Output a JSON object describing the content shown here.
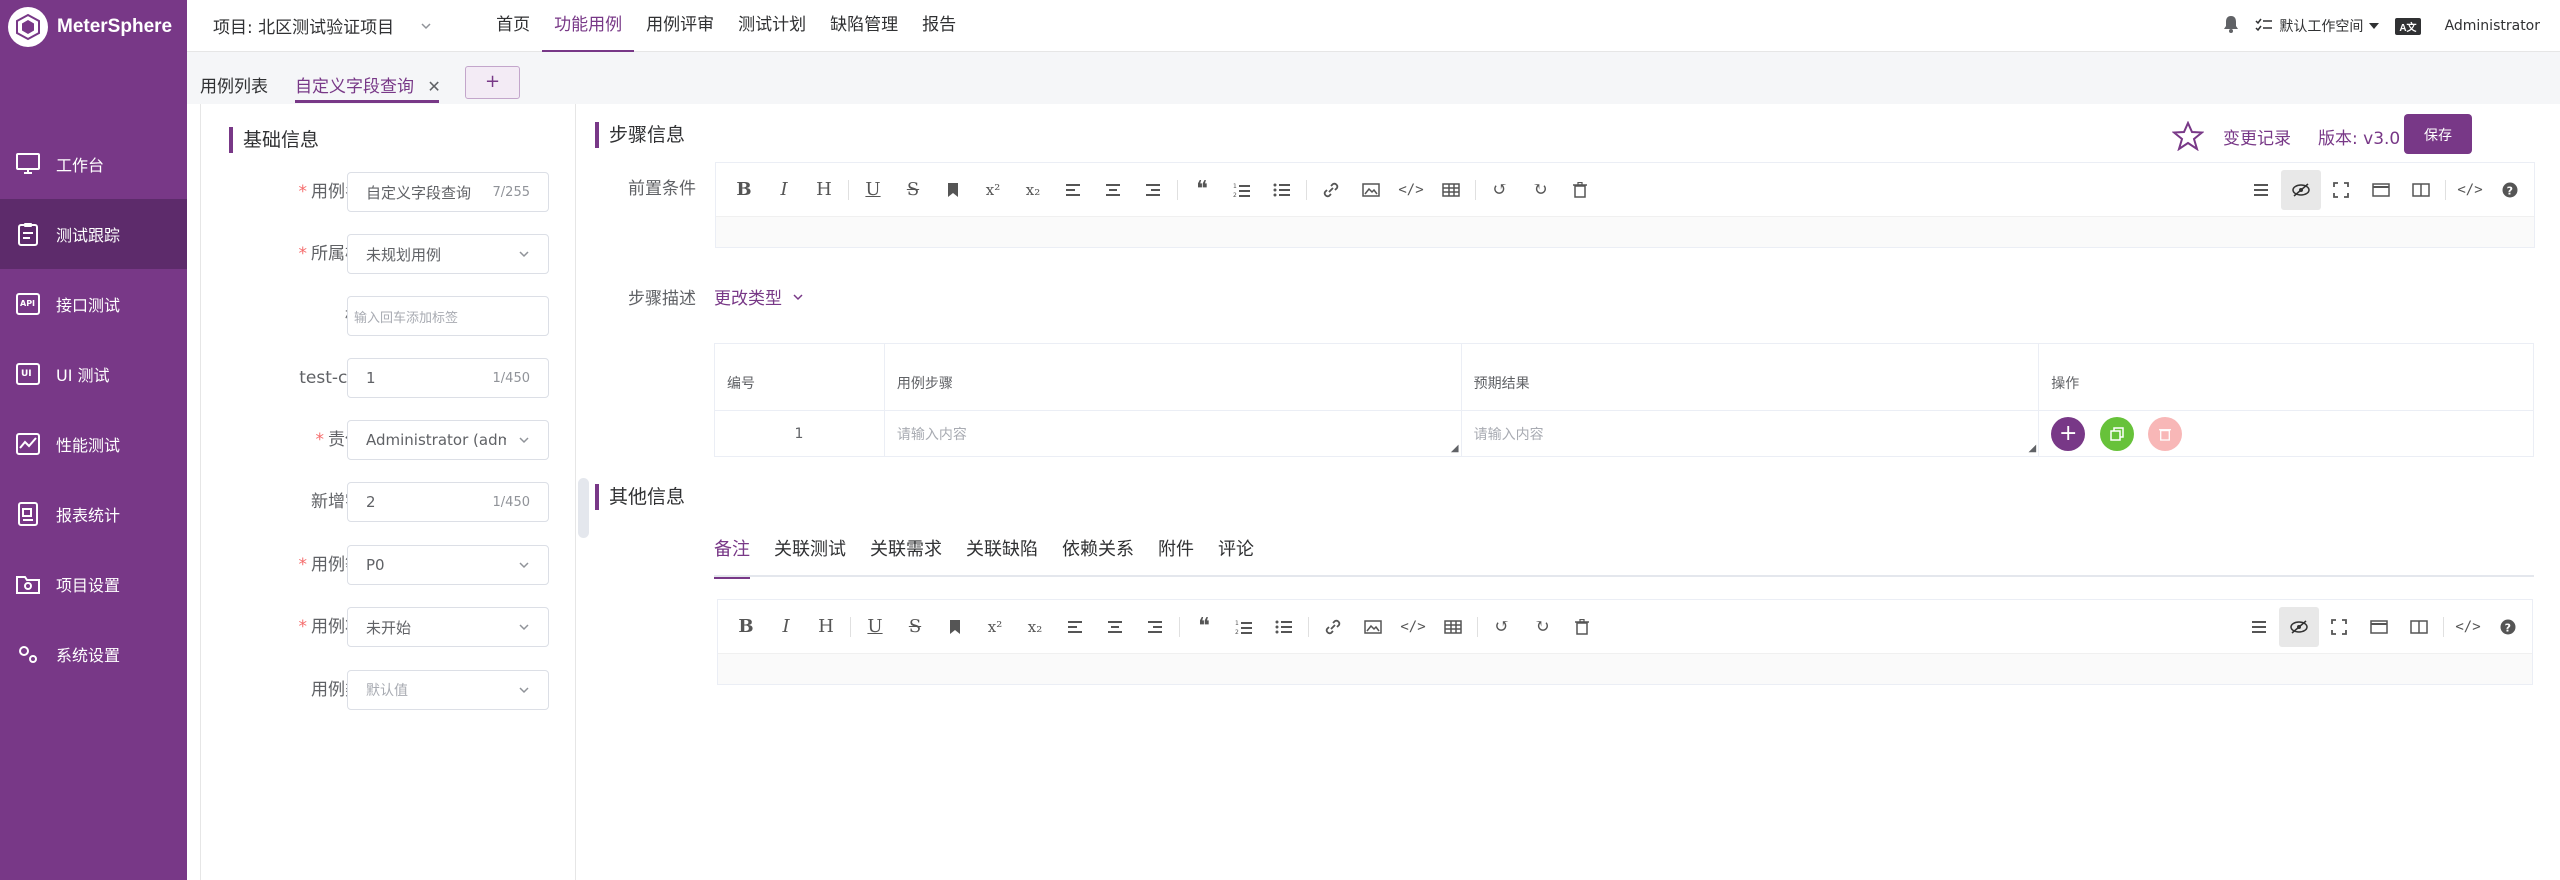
{
  "app": {
    "name": "MeterSphere"
  },
  "sidebar": {
    "items": [
      {
        "label": "工作台",
        "icon": "monitor-icon"
      },
      {
        "label": "测试跟踪",
        "icon": "clipboard-icon",
        "active": true
      },
      {
        "label": "接口测试",
        "icon": "api-icon"
      },
      {
        "label": "UI 测试",
        "icon": "ui-test-icon"
      },
      {
        "label": "性能测试",
        "icon": "performance-chart-icon"
      },
      {
        "label": "报表统计",
        "icon": "report-icon"
      },
      {
        "label": "项目设置",
        "icon": "folder-settings-icon"
      },
      {
        "label": "系统设置",
        "icon": "gear-icon"
      }
    ]
  },
  "header": {
    "project": "项目: 北区测试验证项目",
    "nav": [
      {
        "label": "首页"
      },
      {
        "label": "功能用例",
        "active": true
      },
      {
        "label": "用例评审"
      },
      {
        "label": "测试计划"
      },
      {
        "label": "缺陷管理"
      },
      {
        "label": "报告"
      }
    ],
    "workspace": "默认工作空间",
    "lang_badge": "A文",
    "user": "Administrator"
  },
  "tabs": {
    "list": "用例列表",
    "active": "自定义字段查询",
    "add": "+"
  },
  "basic_info": {
    "title": "基础信息",
    "fields": [
      {
        "label": "用例名称",
        "required": true,
        "value": "自定义字段查询",
        "count": "7/255"
      },
      {
        "label": "所属模块",
        "required": true,
        "value": "未规划用例"
      },
      {
        "label": "标签",
        "required": false,
        "placeholder": "输入回车添加标签"
      },
      {
        "label": "test-code",
        "required": false,
        "value": "1",
        "count": "1/450"
      },
      {
        "label": "责任人",
        "required": true,
        "value": "Administrator (admin)"
      },
      {
        "label": "新增字段",
        "required": false,
        "value": "2",
        "count": "1/450"
      },
      {
        "label": "用例等级",
        "required": true,
        "value": "P0"
      },
      {
        "label": "用例状态",
        "required": true,
        "value": "未开始"
      },
      {
        "label": "用例类型",
        "required": false,
        "placeholder": "默认值"
      }
    ]
  },
  "steps": {
    "title": "步骤信息",
    "change_log": "变更记录",
    "version": "版本: v3.0",
    "save": "保存",
    "precondition_label": "前置条件",
    "step_desc_label": "步骤描述",
    "change_type": "更改类型",
    "table": {
      "headers": [
        "编号",
        "用例步骤",
        "预期结果",
        "操作"
      ],
      "rows": [
        {
          "num": "1",
          "step_placeholder": "请输入内容",
          "result_placeholder": "请输入内容"
        }
      ]
    }
  },
  "other_info": {
    "title": "其他信息",
    "tabs": [
      "备注",
      "关联测试",
      "关联需求",
      "关联缺陷",
      "依赖关系",
      "附件",
      "评论"
    ]
  },
  "colors": {
    "brand": "#783887",
    "success": "#67c23a",
    "danger_light": "#f8b7b7"
  }
}
